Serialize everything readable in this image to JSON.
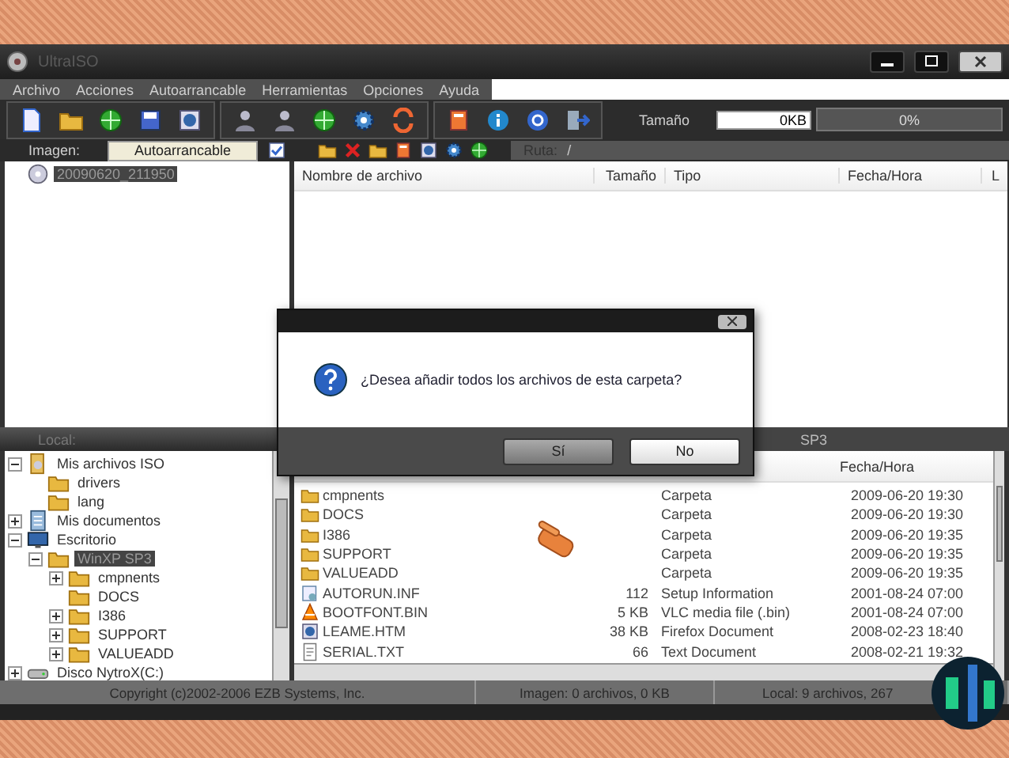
{
  "window": {
    "title": "UltraISO"
  },
  "menu": [
    "Archivo",
    "Acciones",
    "Autoarrancable",
    "Herramientas",
    "Opciones",
    "Ayuda"
  ],
  "toolbar": {
    "size_label": "Tamaño",
    "size_value": "0KB",
    "progress": {
      "level": 0,
      "reading": "0%"
    }
  },
  "image_bar": {
    "label": "Imagen:",
    "boot_button": "Autoarrancable",
    "path_label": "Ruta:",
    "path": "/"
  },
  "image_tree": [
    {
      "label": "20090620_211950",
      "kind": "disc",
      "selected": true
    }
  ],
  "image_list": {
    "columns": [
      "Nombre de archivo",
      "Tamaño",
      "Tipo",
      "Fecha/Hora",
      "L"
    ]
  },
  "local_bar": {
    "label": "Local:",
    "path": "SP3"
  },
  "local_tree": [
    {
      "label": "Mis archivos ISO",
      "kind": "iso",
      "expanded": true,
      "selected": false,
      "children": [
        {
          "label": "drivers",
          "kind": "folder",
          "selected": false
        },
        {
          "label": "lang",
          "kind": "folder",
          "selected": false
        }
      ]
    },
    {
      "label": "Mis documentos",
      "kind": "documents",
      "expanded": false,
      "selected": false
    },
    {
      "label": "Escritorio",
      "kind": "desktop",
      "expanded": true,
      "selected": false,
      "children": [
        {
          "label": "WinXP SP3",
          "kind": "folder",
          "expanded": true,
          "selected": true,
          "children": [
            {
              "label": "cmpnents",
              "kind": "folder",
              "expanded": false,
              "selected": false
            },
            {
              "label": "DOCS",
              "kind": "folder",
              "selected": false
            },
            {
              "label": "I386",
              "kind": "folder",
              "expanded": false,
              "selected": false
            },
            {
              "label": "SUPPORT",
              "kind": "folder",
              "expanded": false,
              "selected": false
            },
            {
              "label": "VALUEADD",
              "kind": "folder",
              "expanded": false,
              "selected": false
            }
          ]
        }
      ]
    },
    {
      "label": "Disco NytroX(C:)",
      "kind": "drive",
      "expanded": false,
      "selected": false
    }
  ],
  "local_list": {
    "column_4": "Fecha/Hora",
    "rows": [
      {
        "kind": "folder",
        "name": "cmpnents",
        "size": "",
        "type": "Carpeta",
        "date": "2009-06-20 19:30"
      },
      {
        "kind": "folder",
        "name": "DOCS",
        "size": "",
        "type": "Carpeta",
        "date": "2009-06-20 19:30"
      },
      {
        "kind": "folder",
        "name": "I386",
        "size": "",
        "type": "Carpeta",
        "date": "2009-06-20 19:35"
      },
      {
        "kind": "folder",
        "name": "SUPPORT",
        "size": "",
        "type": "Carpeta",
        "date": "2009-06-20 19:35"
      },
      {
        "kind": "folder",
        "name": "VALUEADD",
        "size": "",
        "type": "Carpeta",
        "date": "2009-06-20 19:35"
      },
      {
        "kind": "setup",
        "name": "AUTORUN.INF",
        "size": "112",
        "type": "Setup Information",
        "date": "2001-08-24 07:00"
      },
      {
        "kind": "media",
        "name": "BOOTFONT.BIN",
        "size": "5 KB",
        "type": "VLC media file (.bin)",
        "date": "2001-08-24 07:00"
      },
      {
        "kind": "web",
        "name": "LEAME.HTM",
        "size": "38 KB",
        "type": "Firefox Document",
        "date": "2008-02-23 18:40"
      },
      {
        "kind": "text",
        "name": "SERIAL.TXT",
        "size": "66",
        "type": "Text Document",
        "date": "2008-02-21 19:32"
      }
    ]
  },
  "dialog": {
    "message": "¿Desea añadir todos los archivos de esta carpeta?",
    "buttons": [
      {
        "label": "Sí",
        "selected": true
      },
      {
        "label": "No",
        "selected": false
      }
    ]
  },
  "status_bar": [
    "Copyright (c)2002-2006 EZB Systems, Inc.",
    "Imagen: 0 archivos, 0 KB",
    "Local: 9 archivos, 267"
  ]
}
